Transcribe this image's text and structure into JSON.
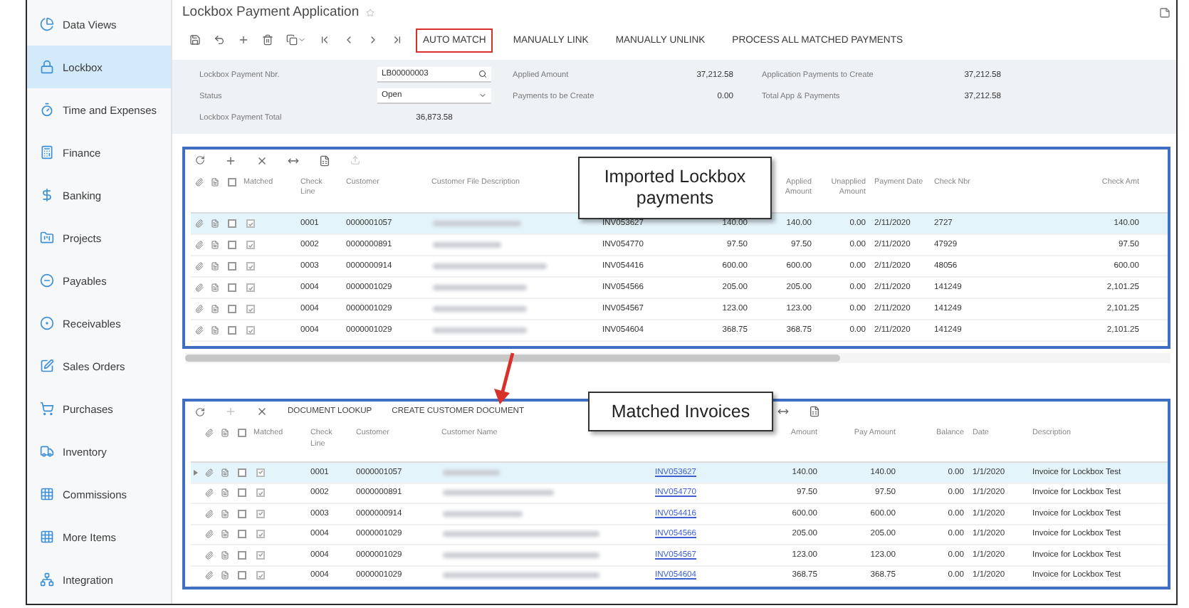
{
  "sidebar": {
    "items": [
      {
        "label": "Data Views",
        "selected": false
      },
      {
        "label": "Lockbox",
        "selected": true
      },
      {
        "label": "Time and Expenses",
        "selected": false
      },
      {
        "label": "Finance",
        "selected": false
      },
      {
        "label": "Banking",
        "selected": false
      },
      {
        "label": "Projects",
        "selected": false
      },
      {
        "label": "Payables",
        "selected": false
      },
      {
        "label": "Receivables",
        "selected": false
      },
      {
        "label": "Sales Orders",
        "selected": false
      },
      {
        "label": "Purchases",
        "selected": false
      },
      {
        "label": "Inventory",
        "selected": false
      },
      {
        "label": "Commissions",
        "selected": false
      },
      {
        "label": "More Items",
        "selected": false
      },
      {
        "label": "Integration",
        "selected": false
      }
    ]
  },
  "page": {
    "title": "Lockbox Payment Application"
  },
  "toolbar": {
    "buttons": [
      {
        "label": "AUTO MATCH",
        "outlined": true
      },
      {
        "label": "MANUALLY LINK",
        "outlined": false
      },
      {
        "label": "MANUALLY UNLINK",
        "outlined": false
      },
      {
        "label": "PROCESS ALL MATCHED PAYMENTS",
        "outlined": false
      }
    ]
  },
  "form": {
    "columns": [
      [
        {
          "label": "Lockbox Payment Nbr.",
          "value": "LB00000003",
          "kind": "lookup"
        },
        {
          "label": "Status",
          "value": "Open",
          "kind": "select"
        },
        {
          "label": "Lockbox Payment Total",
          "value": "36,873.58",
          "kind": "readonly"
        }
      ],
      [
        {
          "label": "Applied Amount",
          "value": "37,212.58",
          "kind": "number"
        },
        {
          "label": "Payments to be Create",
          "value": "0.00",
          "kind": "number"
        }
      ],
      [
        {
          "label": "Application Payments to Create",
          "value": "37,212.58",
          "kind": "number"
        },
        {
          "label": "Total App & Payments",
          "value": "37,212.58",
          "kind": "number"
        }
      ]
    ]
  },
  "top_grid": {
    "callout": "Imported Lockbox payments",
    "all_checked": false,
    "matched_header": "Matched",
    "columns": [
      {
        "label": "Check Line"
      },
      {
        "label": "Customer"
      },
      {
        "label": "Customer File Description"
      },
      {},
      {},
      {
        "label": "Applied Amount"
      },
      {
        "label": "Unapplied Amount"
      },
      {
        "label": "Payment Date"
      },
      {
        "label": "Check Nbr"
      },
      {
        "label": "Check Amt"
      }
    ],
    "rows": [
      {
        "selected": true,
        "checked": false,
        "matched": true,
        "cells": [
          "0001",
          "0000001057",
          "",
          "INV053627",
          "140.00",
          "140.00",
          "0.00",
          "2/11/2020",
          "2727",
          "140.00"
        ]
      },
      {
        "selected": false,
        "checked": false,
        "matched": true,
        "cells": [
          "0002",
          "0000000891",
          "",
          "INV054770",
          "97.50",
          "97.50",
          "0.00",
          "2/11/2020",
          "47929",
          "97.50"
        ]
      },
      {
        "selected": false,
        "checked": false,
        "matched": true,
        "cells": [
          "0003",
          "0000000914",
          "",
          "INV054416",
          "600.00",
          "600.00",
          "0.00",
          "2/11/2020",
          "48056",
          "600.00"
        ]
      },
      {
        "selected": false,
        "checked": false,
        "matched": true,
        "cells": [
          "0004",
          "0000001029",
          "",
          "INV054566",
          "205.00",
          "205.00",
          "0.00",
          "2/11/2020",
          "141249",
          "2,101.25"
        ]
      },
      {
        "selected": false,
        "checked": false,
        "matched": true,
        "cells": [
          "0004",
          "0000001029",
          "",
          "INV054567",
          "123.00",
          "123.00",
          "0.00",
          "2/11/2020",
          "141249",
          "2,101.25"
        ]
      },
      {
        "selected": false,
        "checked": false,
        "matched": true,
        "cells": [
          "0004",
          "0000001029",
          "",
          "INV054604",
          "368.75",
          "368.75",
          "0.00",
          "2/11/2020",
          "141249",
          "2,101.25"
        ]
      }
    ]
  },
  "bottom_grid": {
    "callout": "Matched Invoices",
    "buttons": [
      {
        "label": "DOCUMENT LOOKUP"
      },
      {
        "label": "CREATE CUSTOMER DOCUMENT"
      }
    ],
    "all_checked": false,
    "matched_header": "Matched",
    "columns": [
      {
        "label": "Check Line"
      },
      {
        "label": "Customer"
      },
      {
        "label": "Customer Name"
      },
      {},
      {
        "label": "Amount"
      },
      {
        "label": "Pay Amount"
      },
      {
        "label": "Balance"
      },
      {
        "label": "Date"
      },
      {
        "label": "Description"
      }
    ],
    "rows": [
      {
        "selected": true,
        "checked": false,
        "matched": true,
        "cells": [
          "0001",
          "0000001057",
          "",
          "INV053627",
          "140.00",
          "140.00",
          "0.00",
          "1/1/2020",
          "Invoice for Lockbox Test"
        ]
      },
      {
        "selected": false,
        "checked": false,
        "matched": true,
        "cells": [
          "0002",
          "0000000891",
          "",
          "INV054770",
          "97.50",
          "97.50",
          "0.00",
          "1/1/2020",
          "Invoice for Lockbox Test"
        ]
      },
      {
        "selected": false,
        "checked": false,
        "matched": true,
        "cells": [
          "0003",
          "0000000914",
          "",
          "INV054416",
          "600.00",
          "600.00",
          "0.00",
          "1/1/2020",
          "Invoice for Lockbox Test"
        ]
      },
      {
        "selected": false,
        "checked": false,
        "matched": true,
        "cells": [
          "0004",
          "0000001029",
          "",
          "INV054566",
          "205.00",
          "205.00",
          "0.00",
          "1/1/2020",
          "Invoice for Lockbox Test"
        ]
      },
      {
        "selected": false,
        "checked": false,
        "matched": true,
        "cells": [
          "0004",
          "0000001029",
          "",
          "INV054567",
          "123.00",
          "123.00",
          "0.00",
          "1/1/2020",
          "Invoice for Lockbox Test"
        ]
      },
      {
        "selected": false,
        "checked": false,
        "matched": true,
        "cells": [
          "0004",
          "0000001029",
          "",
          "INV054604",
          "368.75",
          "368.75",
          "0.00",
          "1/1/2020",
          "Invoice for Lockbox Test"
        ]
      }
    ]
  }
}
